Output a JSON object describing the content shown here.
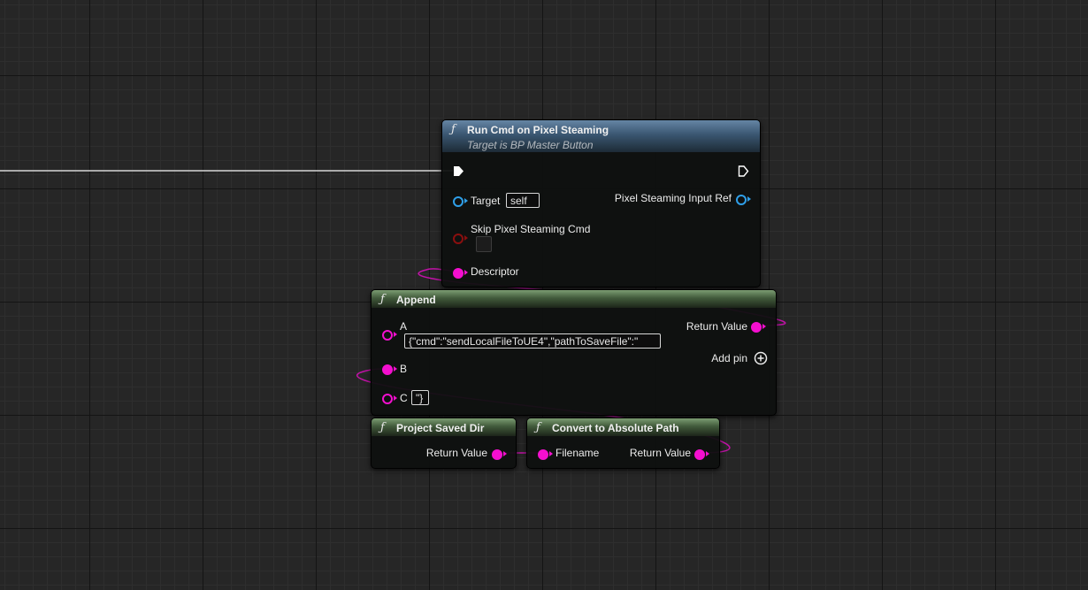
{
  "colors": {
    "string_pin": "#f40fcf",
    "object_pin": "#2f9fe8",
    "bool_pin": "#8a0f0f",
    "exec_pin": "#ffffff",
    "grid_bg": "#262626"
  },
  "nodes": {
    "run_cmd": {
      "icon": "function-icon",
      "title": "Run Cmd on Pixel Steaming",
      "subtitle": "Target is BP Master Button",
      "target_label": "Target",
      "target_value": "self",
      "output_label": "Pixel Steaming Input Ref",
      "skip_label": "Skip Pixel Steaming Cmd",
      "skip_checked": false,
      "descriptor_label": "Descriptor"
    },
    "append": {
      "icon": "function-icon",
      "title": "Append",
      "a_label": "A",
      "a_value": "{\"cmd\":\"sendLocalFileToUE4\",\"pathToSaveFile\":\"",
      "b_label": "B",
      "c_label": "C",
      "c_value": "\"}",
      "return_label": "Return Value",
      "add_pin_label": "Add pin"
    },
    "project_saved_dir": {
      "icon": "function-icon",
      "title": "Project Saved Dir",
      "return_label": "Return Value"
    },
    "convert_path": {
      "icon": "function-icon",
      "title": "Convert to Absolute Path",
      "input_label": "Filename",
      "return_label": "Return Value"
    }
  }
}
